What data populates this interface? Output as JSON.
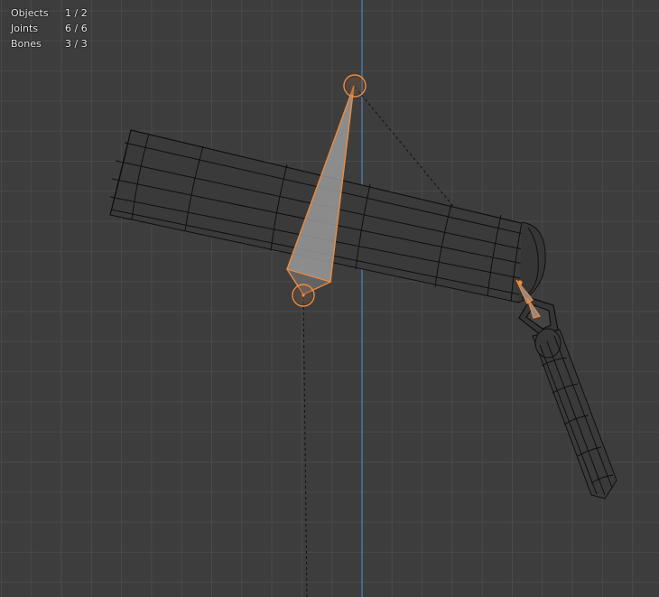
{
  "overlay": {
    "stats": [
      {
        "label": "Objects",
        "value": "1 / 2"
      },
      {
        "label": "Joints",
        "value": "6 / 6"
      },
      {
        "label": "Bones",
        "value": "3 / 3"
      }
    ]
  },
  "colors": {
    "background": "#3d3d3d",
    "grid_line": "#4a4a4a",
    "grid_major": "#555555",
    "z_axis": "#5680c2",
    "wire": "#0d0d0d",
    "mesh_face": "#3a3a3a",
    "bone_selected": "#f08a3c",
    "bone_fill": "#9a9a9a"
  },
  "icons": {
    "bone": "bone-icon",
    "joint": "joint-icon"
  }
}
